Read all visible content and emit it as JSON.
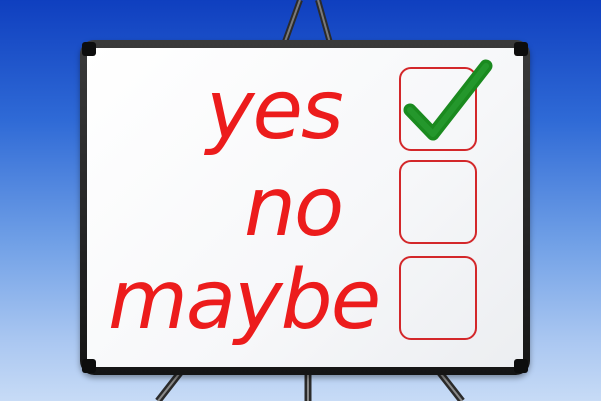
{
  "options": [
    {
      "label": "yes",
      "checked": true
    },
    {
      "label": "no",
      "checked": false
    },
    {
      "label": "maybe",
      "checked": false
    }
  ],
  "colors": {
    "text": "#ec1c1c",
    "checkbox_border": "#d3272a",
    "check_mark": "#1a8a1f",
    "board_frame": "#1c1c1c",
    "sky_top": "#0f3fbf",
    "sky_bottom": "#c7dbf6"
  },
  "icons": {
    "check": "check-mark-icon"
  }
}
